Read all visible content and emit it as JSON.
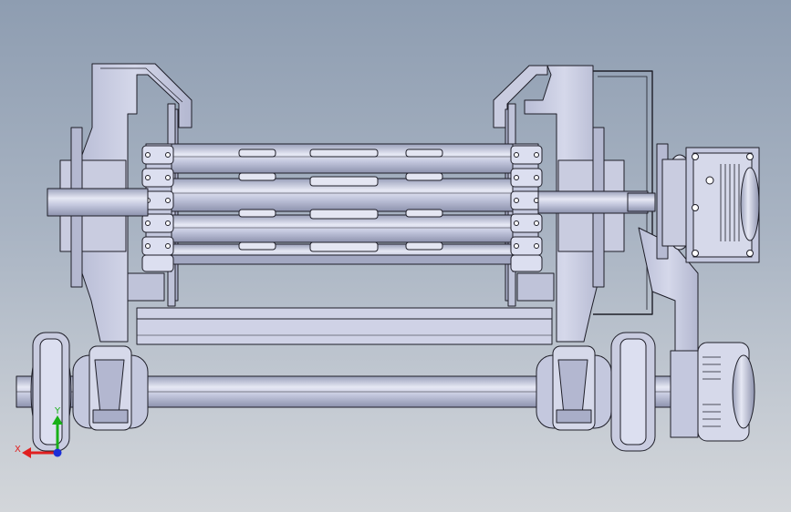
{
  "canvas": {
    "background_top": "#8e9db1",
    "background_bottom": "#d3d6da"
  },
  "triad": {
    "x_label": "X",
    "y_label": "Y",
    "x_color": "#e02020",
    "y_color": "#18b018",
    "z_color": "#1c2fd8"
  },
  "model": {
    "part_fill": "#c4c8de",
    "part_fill_dark": "#9ea3bd",
    "part_fill_light": "#dcdff0",
    "edge_color": "#1e1e28"
  }
}
